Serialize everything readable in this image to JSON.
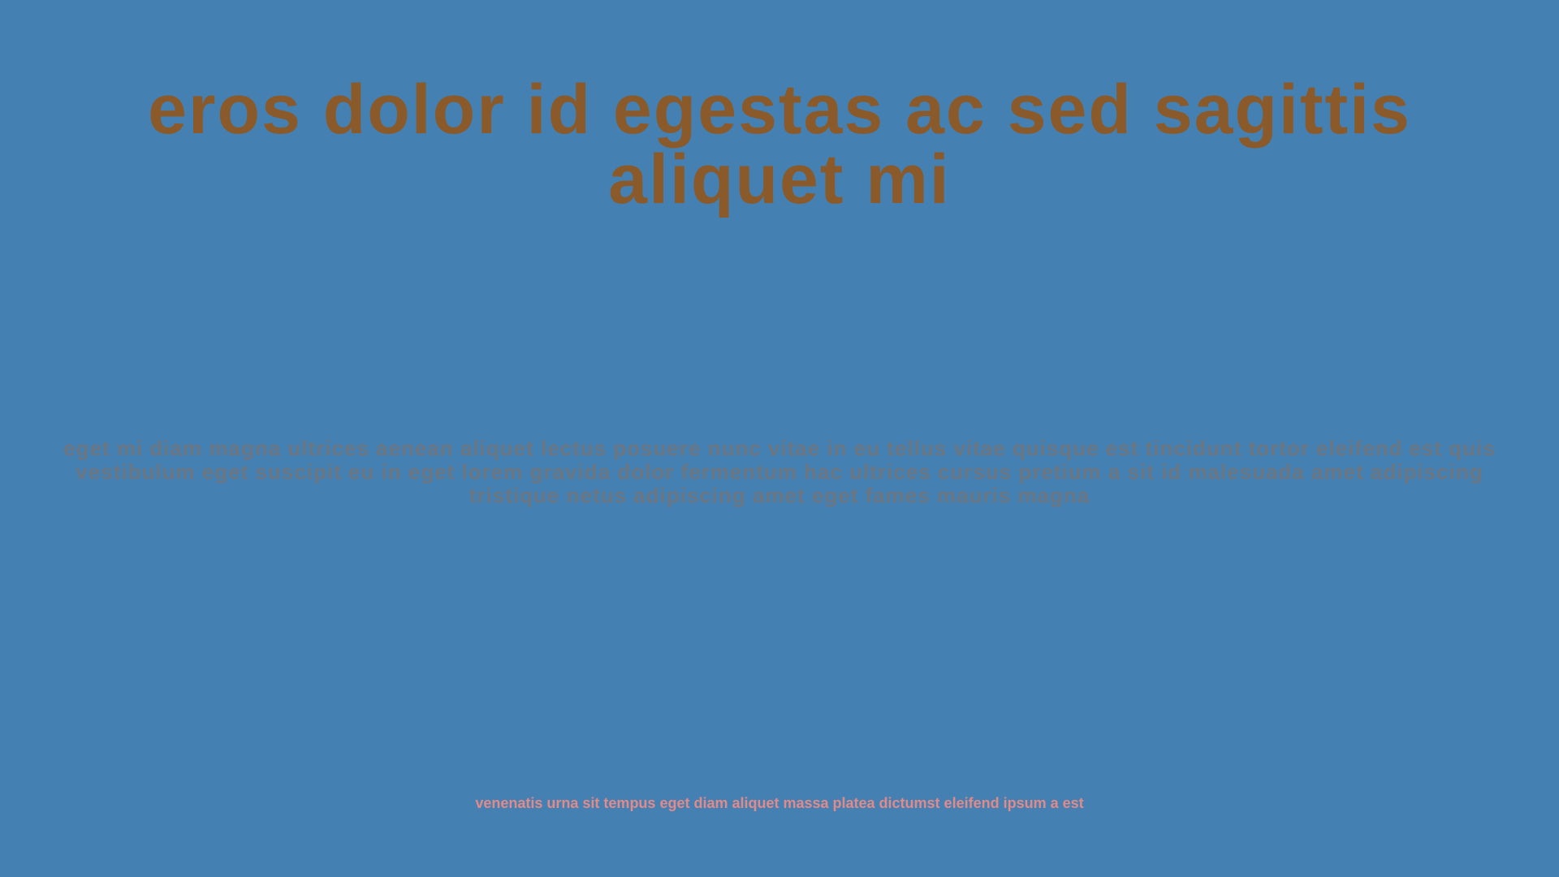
{
  "slide": {
    "title": "eros dolor id egestas ac sed sagittis aliquet mi",
    "body": "eget mi diam magna ultrices aenean aliquet lectus posuere nunc vitae in eu tellus vitae quisque est tincidunt tortor eleifend est quis vestibulum eget suscipit eu in eget lorem gravida dolor fermentum hac ultrices cursus pretium a sit id malesuada amet adipiscing tristique netus adipiscing amet eget fames mauris magna",
    "footer": "venenatis urna sit tempus eget diam aliquet massa platea dictumst eleifend ipsum a est"
  },
  "colors": {
    "background": "#4580b2",
    "title": "#8a5a2b",
    "body": "#6b7683",
    "footer": "#e08a8a"
  }
}
